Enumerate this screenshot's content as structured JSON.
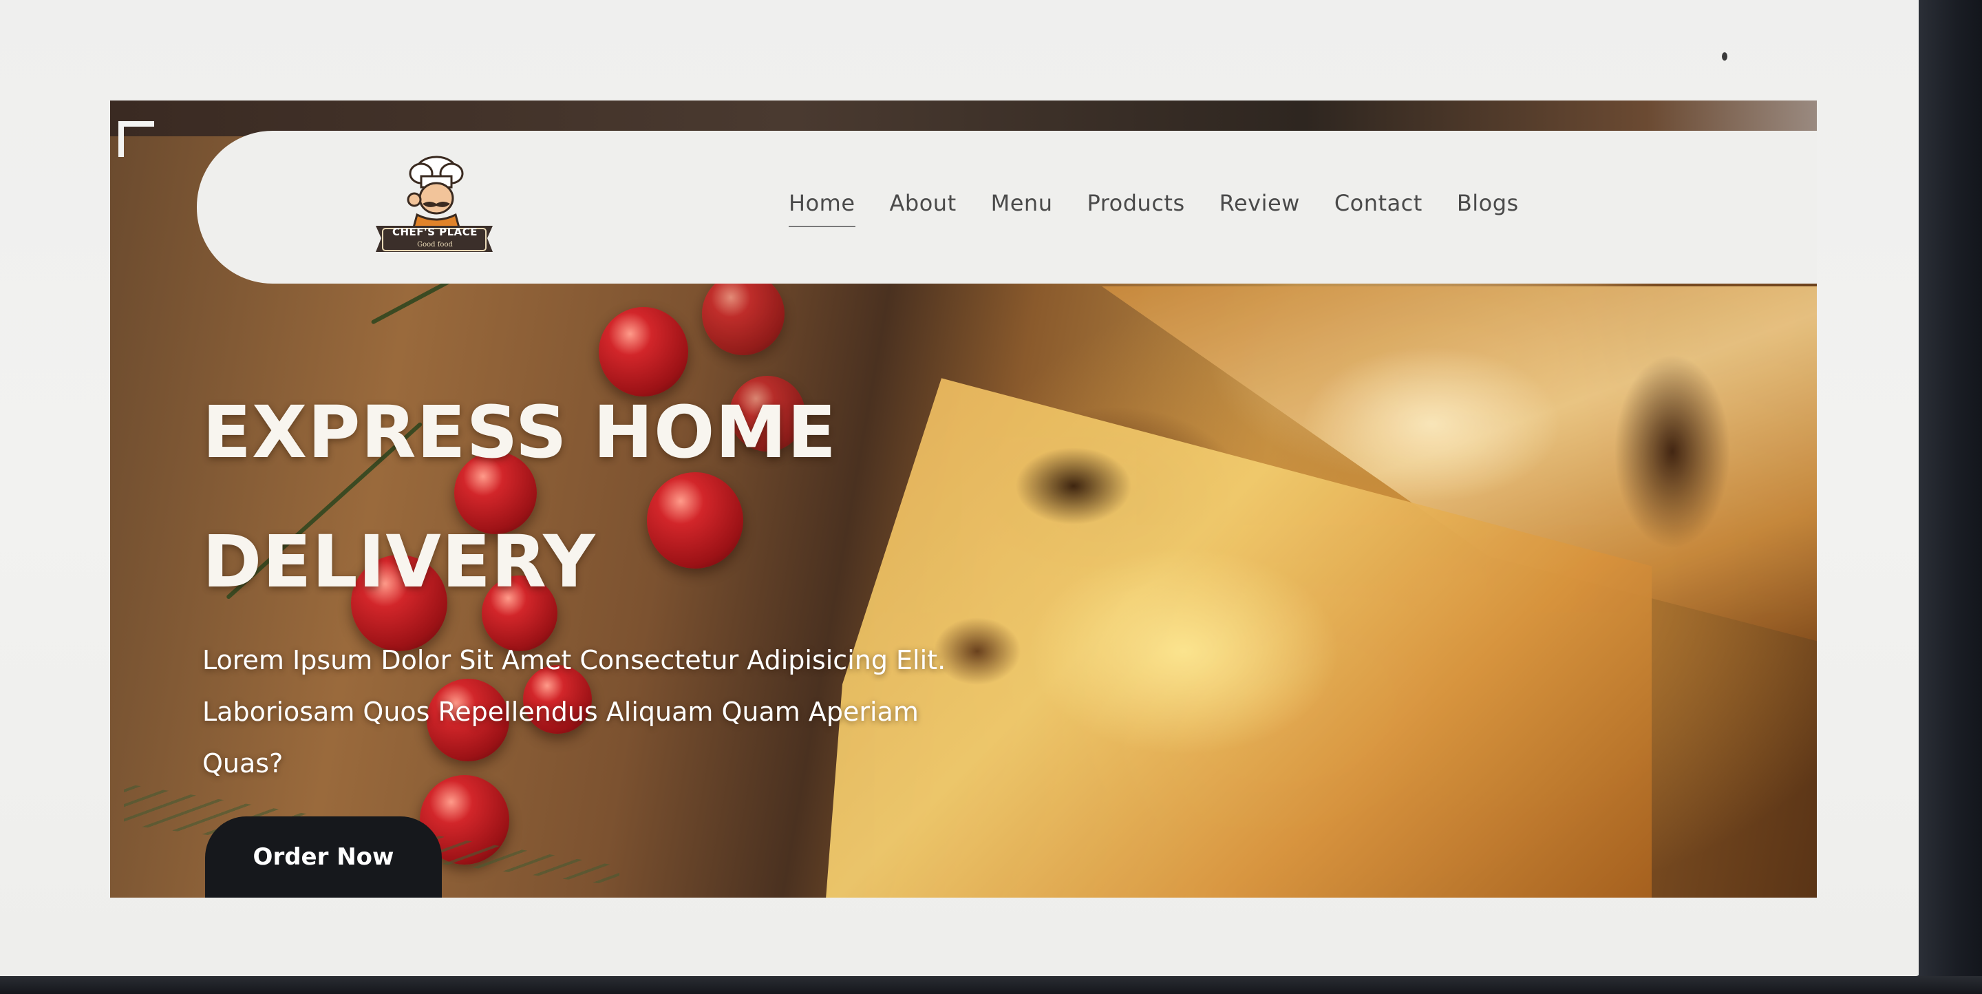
{
  "brand": {
    "logo_text": "CHEF'S PLACE",
    "logo_subtext": "Good food",
    "logo_icon": "chef-mascot-icon"
  },
  "nav": {
    "active": "Home",
    "items": [
      "Home",
      "About",
      "Menu",
      "Products",
      "Review",
      "Contact",
      "Blogs"
    ]
  },
  "hero": {
    "title_line1": "EXPRESS HOME",
    "title_line2": "DELIVERY",
    "description_line1": "Lorem Ipsum Dolor Sit Amet Consectetur Adipisicing Elit.",
    "description_line2": "Laboriosam Quos Repellendus Aliquam Quam Aperiam",
    "description_line3": "Quas?",
    "cta_label": "Order Now",
    "background_image": "pizza-with-cherry-tomatoes-image"
  },
  "colors": {
    "nav_background": "#efefed",
    "nav_text": "#4a4a4a",
    "hero_text": "#ffffff",
    "cta_background": "#16181c",
    "cta_text": "#ffffff"
  }
}
